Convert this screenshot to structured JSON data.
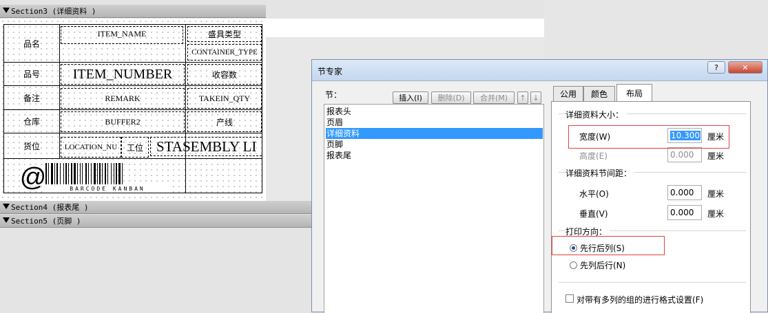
{
  "designer": {
    "sections": {
      "section3": "Section3 (详细资料  )",
      "section4": "Section4 (报表尾  )",
      "section5": "Section5 (页脚  )"
    },
    "labels": {
      "item_name_label": "品名",
      "item_number_label": "品号",
      "remark_label": "备注",
      "warehouse_label": "仓库",
      "location_label": "货位",
      "container_type_label": "盛具类型",
      "capacity_label": "收容数",
      "production_line_label": "产线",
      "station_label": "工位"
    },
    "fields": {
      "item_name": "ITEM_NAME",
      "container_type": "CONTAINER_TYPE",
      "item_number": "ITEM_NUMBER",
      "remark": "REMARK",
      "takein_qty": "TAKEIN_QTY",
      "buffer": "BUFFER2",
      "location": "LOCATION_NU",
      "assembly": "STASEMBLY LI",
      "barcode_symbol": "@",
      "barcode_text": "BARCODE  KANBAN"
    }
  },
  "dialog": {
    "title": "节专家",
    "help_button": "?",
    "close_button": "✕",
    "section_list_label": "节：",
    "buttons": {
      "insert": "插入(I)",
      "delete": "删除(D)",
      "merge": "合并(M)",
      "up": "↑",
      "down": "↓"
    },
    "section_items": [
      "报表头",
      "页眉",
      "详细资料",
      "页脚",
      "报表尾"
    ],
    "selected_index": 2,
    "tabs": [
      "公用",
      "颜色",
      "布局"
    ],
    "active_tab": "布局",
    "detail_size": {
      "title": "详细资料大小：",
      "width_label": "宽度(W)",
      "width_value": "10.300",
      "height_label": "高度(E)",
      "height_value": "0.000",
      "unit": "厘米"
    },
    "spacing": {
      "title": "详细资料节间距：",
      "horizontal_label": "水平(O)",
      "horizontal_value": "0.000",
      "vertical_label": "垂直(V)",
      "vertical_value": "0.000",
      "unit": "厘米"
    },
    "print_direction": {
      "title": "打印方向：",
      "option_row_first": "先行后列(S)",
      "option_col_first": "先列后行(N)",
      "selected": "先行后列(S)"
    },
    "multi_column_checkbox": "对带有多列的组的进行格式设置(F)"
  }
}
